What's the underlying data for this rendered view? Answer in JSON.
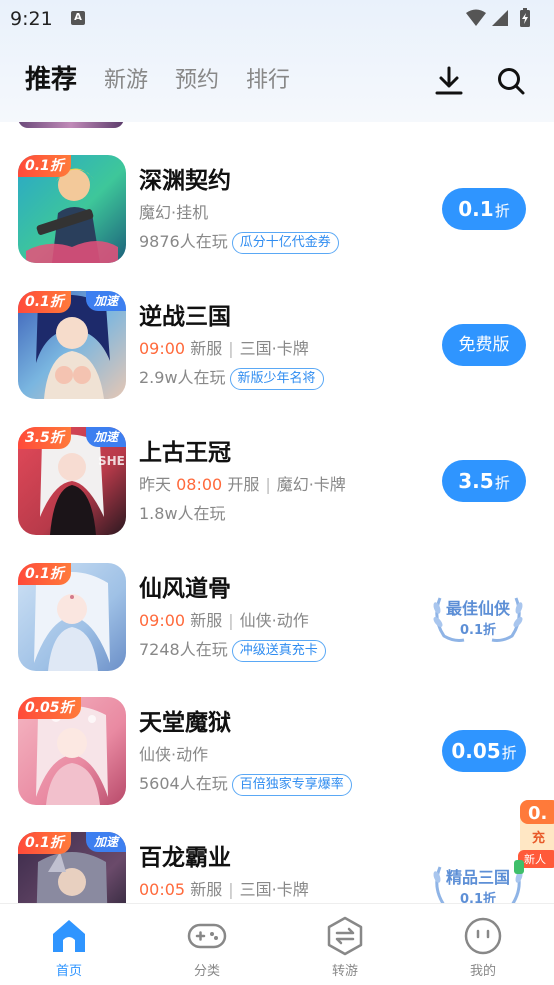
{
  "status_bar": {
    "time": "9:21",
    "notification_letter": "A"
  },
  "header": {
    "tabs": [
      {
        "label": "推荐",
        "active": true
      },
      {
        "label": "新游",
        "active": false
      },
      {
        "label": "预约",
        "active": false
      },
      {
        "label": "排行",
        "active": false
      }
    ],
    "icons": [
      "download-icon",
      "search-icon"
    ]
  },
  "games": [
    {
      "name": "深渊契约",
      "badge": "0.1折",
      "speed_badge": "",
      "meta": {
        "prefix": "",
        "time": "",
        "status": "",
        "category": "魔幻·挂机"
      },
      "players": "9876人在玩",
      "tag": "瓜分十亿代金券",
      "button": {
        "value": "0.1",
        "unit": "折"
      }
    },
    {
      "name": "逆战三国",
      "badge": "0.1折",
      "speed_badge": "加速",
      "meta": {
        "prefix": "",
        "time": "09:00",
        "status": "新服",
        "category": "三国·卡牌"
      },
      "players": "2.9w人在玩",
      "tag": "新版少年名将",
      "button": {
        "label": "免费版"
      }
    },
    {
      "name": "上古王冠",
      "badge": "3.5折",
      "speed_badge": "加速",
      "meta": {
        "prefix": "昨天",
        "time": "08:00",
        "status": "开服",
        "category": "魔幻·卡牌"
      },
      "players": "1.8w人在玩",
      "tag": "",
      "button": {
        "value": "3.5",
        "unit": "折"
      }
    },
    {
      "name": "仙风道骨",
      "badge": "0.1折",
      "speed_badge": "",
      "meta": {
        "prefix": "",
        "time": "09:00",
        "status": "新服",
        "category": "仙侠·动作"
      },
      "players": "7248人在玩",
      "tag": "冲级送真充卡",
      "award": {
        "title": "最佳仙侠",
        "sub": "0.1折"
      }
    },
    {
      "name": "天堂魔狱",
      "badge": "0.05折",
      "speed_badge": "",
      "meta": {
        "prefix": "",
        "time": "",
        "status": "",
        "category": "仙侠·动作"
      },
      "players": "5604人在玩",
      "tag": "百倍独家专享爆率",
      "button": {
        "value": "0.05",
        "unit": "折"
      }
    },
    {
      "name": "百龙霸业",
      "badge": "0.1折",
      "speed_badge": "加速",
      "meta": {
        "prefix": "",
        "time": "00:05",
        "status": "新服",
        "category": "三国·卡牌"
      },
      "players": "",
      "tag": "",
      "award": {
        "title": "精品三国",
        "sub": "0.1折"
      }
    }
  ],
  "floating_promo": {
    "line1": "0.",
    "line2": "充",
    "line3": "新人"
  },
  "bottom_nav": [
    {
      "label": "首页",
      "icon": "home-icon",
      "active": true
    },
    {
      "label": "分类",
      "icon": "gamepad-icon",
      "active": false
    },
    {
      "label": "转游",
      "icon": "transfer-icon",
      "active": false
    },
    {
      "label": "我的",
      "icon": "profile-icon",
      "active": false
    }
  ],
  "colors": {
    "accent": "#2f95ff",
    "highlight": "#ff6a3c",
    "badge": "#ff4a3a",
    "speed": "#3d7ff0"
  }
}
